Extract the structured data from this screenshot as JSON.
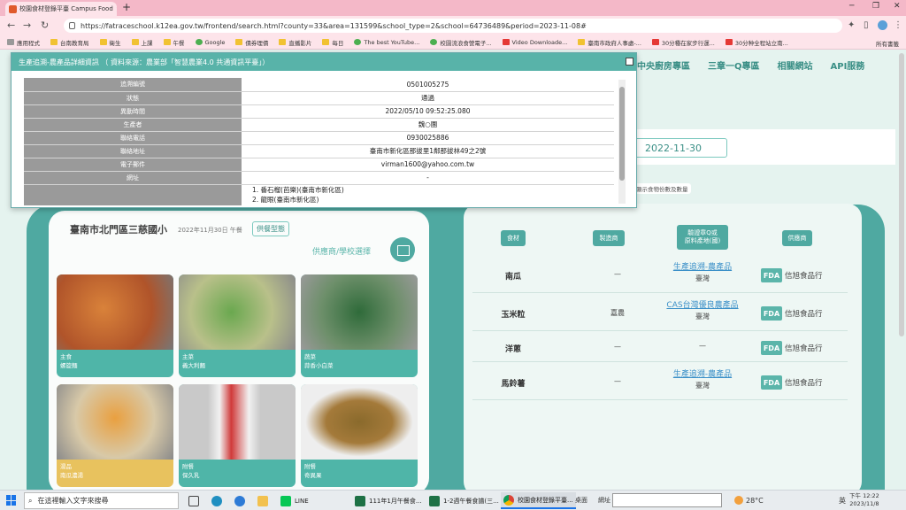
{
  "browser": {
    "tab_title": "校園食材登錄平臺 Campus Food",
    "url": "https://fatraceschool.k12ea.gov.tw/frontend/search.html?county=33&area=131599&school_type=2&school=64736489&period=2023-11-08#",
    "bookmarks": [
      "應用程式",
      "台南教育局",
      "衛生",
      "上課",
      "午餐",
      "Google",
      "債券理債",
      "直播影片",
      "每日",
      "The best YouTube...",
      "校園流浪食營電子...",
      "Video Downloade...",
      "臺南市政府人事處-...",
      "30分種在家步行運...",
      "30分种全程站立南..."
    ],
    "bookmarks_all": "所有書籤"
  },
  "topnav": [
    "學校中央廚房專區",
    "三章一Q專區",
    "相關網站",
    "API服務"
  ],
  "selected_date": "2022-11-30",
  "filter_label": "顯示食物份數及數量",
  "modal": {
    "title": "生產追溯-農產品詳細資訊 （ 資料來源：農業部「智慧農業4.0 共通資訊平臺」）",
    "rows": [
      {
        "k": "追溯編號",
        "v": "0501005275"
      },
      {
        "k": "狀態",
        "v": "通過"
      },
      {
        "k": "異動時間",
        "v": "2022/05/10 09:52:25.080"
      },
      {
        "k": "生產者",
        "v": "魏○團"
      },
      {
        "k": "聯絡電話",
        "v": "0930025886"
      },
      {
        "k": "聯絡地址",
        "v": "臺南市新化區那拔里1鄰那拔林49之2號"
      },
      {
        "k": "電子郵件",
        "v": "virman1600@yahoo.com.tw"
      },
      {
        "k": "網址",
        "v": "-"
      }
    ],
    "outlets": [
      "1. 番石榴(芭樂)(臺南市新化區)",
      "2. 龍眼(臺南市新化區)"
    ]
  },
  "school_card": {
    "school_name": "臺南市北門區三慈國小",
    "meal_date": "2022年11月30日 午餐",
    "meal_type_button": "供餐型態",
    "supplier_link": "供應商/學校選擇",
    "dishes": [
      {
        "category": "主食",
        "name": "螺旋麵"
      },
      {
        "category": "主菜",
        "name": "義大利麵"
      },
      {
        "category": "蔬菜",
        "name": "蒜香小白菜"
      },
      {
        "category": "湯品",
        "name": "南瓜濃湯"
      },
      {
        "category": "附餐",
        "name": "保久乳"
      },
      {
        "category": "附餐",
        "name": "奇異果"
      }
    ]
  },
  "ingredients": {
    "headers": [
      "食材",
      "製造商",
      "驗證章Q或\n原料產地(國)",
      "供應商"
    ],
    "rows": [
      {
        "name": "南瓜",
        "manufacturer": "—",
        "cert": "生產追溯-農產品",
        "origin": "臺灣",
        "badge": "FDA",
        "supplier": "信旭食品行"
      },
      {
        "name": "玉米粒",
        "manufacturer": "嘉農",
        "cert": "CAS台灣優良農產品",
        "origin": "臺灣",
        "badge": "FDA",
        "supplier": "信旭食品行"
      },
      {
        "name": "洋蔥",
        "manufacturer": "—",
        "cert": "",
        "origin": "—",
        "badge": "FDA",
        "supplier": "信旭食品行"
      },
      {
        "name": "馬鈴薯",
        "manufacturer": "—",
        "cert": "生產追溯-農產品",
        "origin": "臺灣",
        "badge": "FDA",
        "supplier": "信旭食品行"
      }
    ]
  },
  "taskbar": {
    "search_placeholder": "在這裡輸入文字來搜尋",
    "apps": [
      "LINE",
      "111年1月午餐食...",
      "1-2週午餐食譜(三...",
      "校園食材登錄平臺..."
    ],
    "desktop": "桌面",
    "address": "網址",
    "weather": "28°C",
    "lang": "英",
    "time": "下午 12:22",
    "date": "2023/11/8"
  }
}
